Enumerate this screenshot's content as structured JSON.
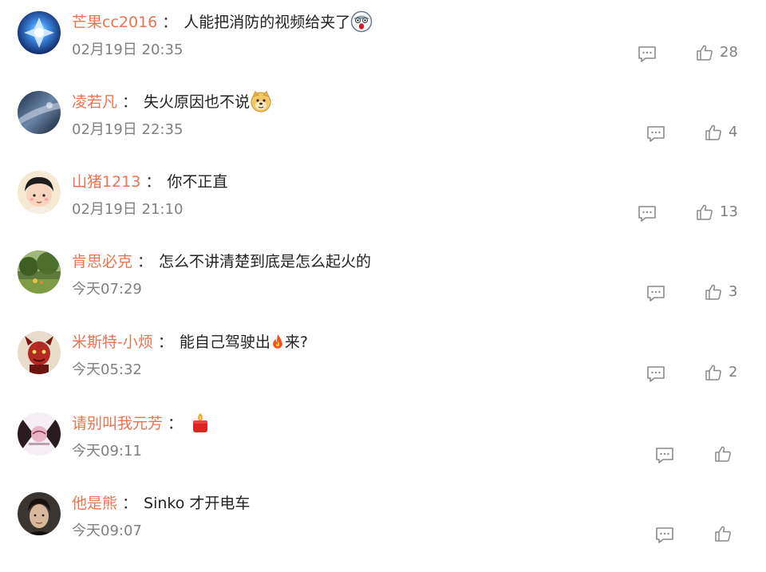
{
  "comments": [
    {
      "username": "芒果cc2016",
      "separator": "：",
      "text": "人能把消防的视频给夹了",
      "emoji": "panic-face-emoji",
      "time": "02月19日 20:35",
      "likes": "28"
    },
    {
      "username": "凌若凡",
      "separator": "：",
      "text": "失火原因也不说",
      "emoji": "doge-emoji",
      "time": "02月19日 22:35",
      "likes": "4"
    },
    {
      "username": "山猪1213",
      "separator": "：",
      "text": "你不正直",
      "time": "02月19日 21:10",
      "likes": "13"
    },
    {
      "username": "肯思必克",
      "separator": "：",
      "text": "怎么不讲清楚到底是怎么起火的",
      "time": "今天07:29",
      "likes": "3"
    },
    {
      "username": "米斯特-小烦",
      "separator": "：",
      "text_before": "能自己驾驶出",
      "emoji": "fire-emoji",
      "text_after": "来?",
      "time": "今天05:32",
      "likes": "2"
    },
    {
      "username": "请别叫我元芳",
      "separator": "：",
      "emoji": "candle-emoji",
      "time": "今天09:11"
    },
    {
      "username": "他是熊",
      "separator": "：",
      "text": "Sinko 才开电车",
      "time": "今天09:07"
    }
  ],
  "colors": {
    "username": "#eb7350",
    "timestamp": "#808080",
    "icon": "#8a8a8a"
  }
}
